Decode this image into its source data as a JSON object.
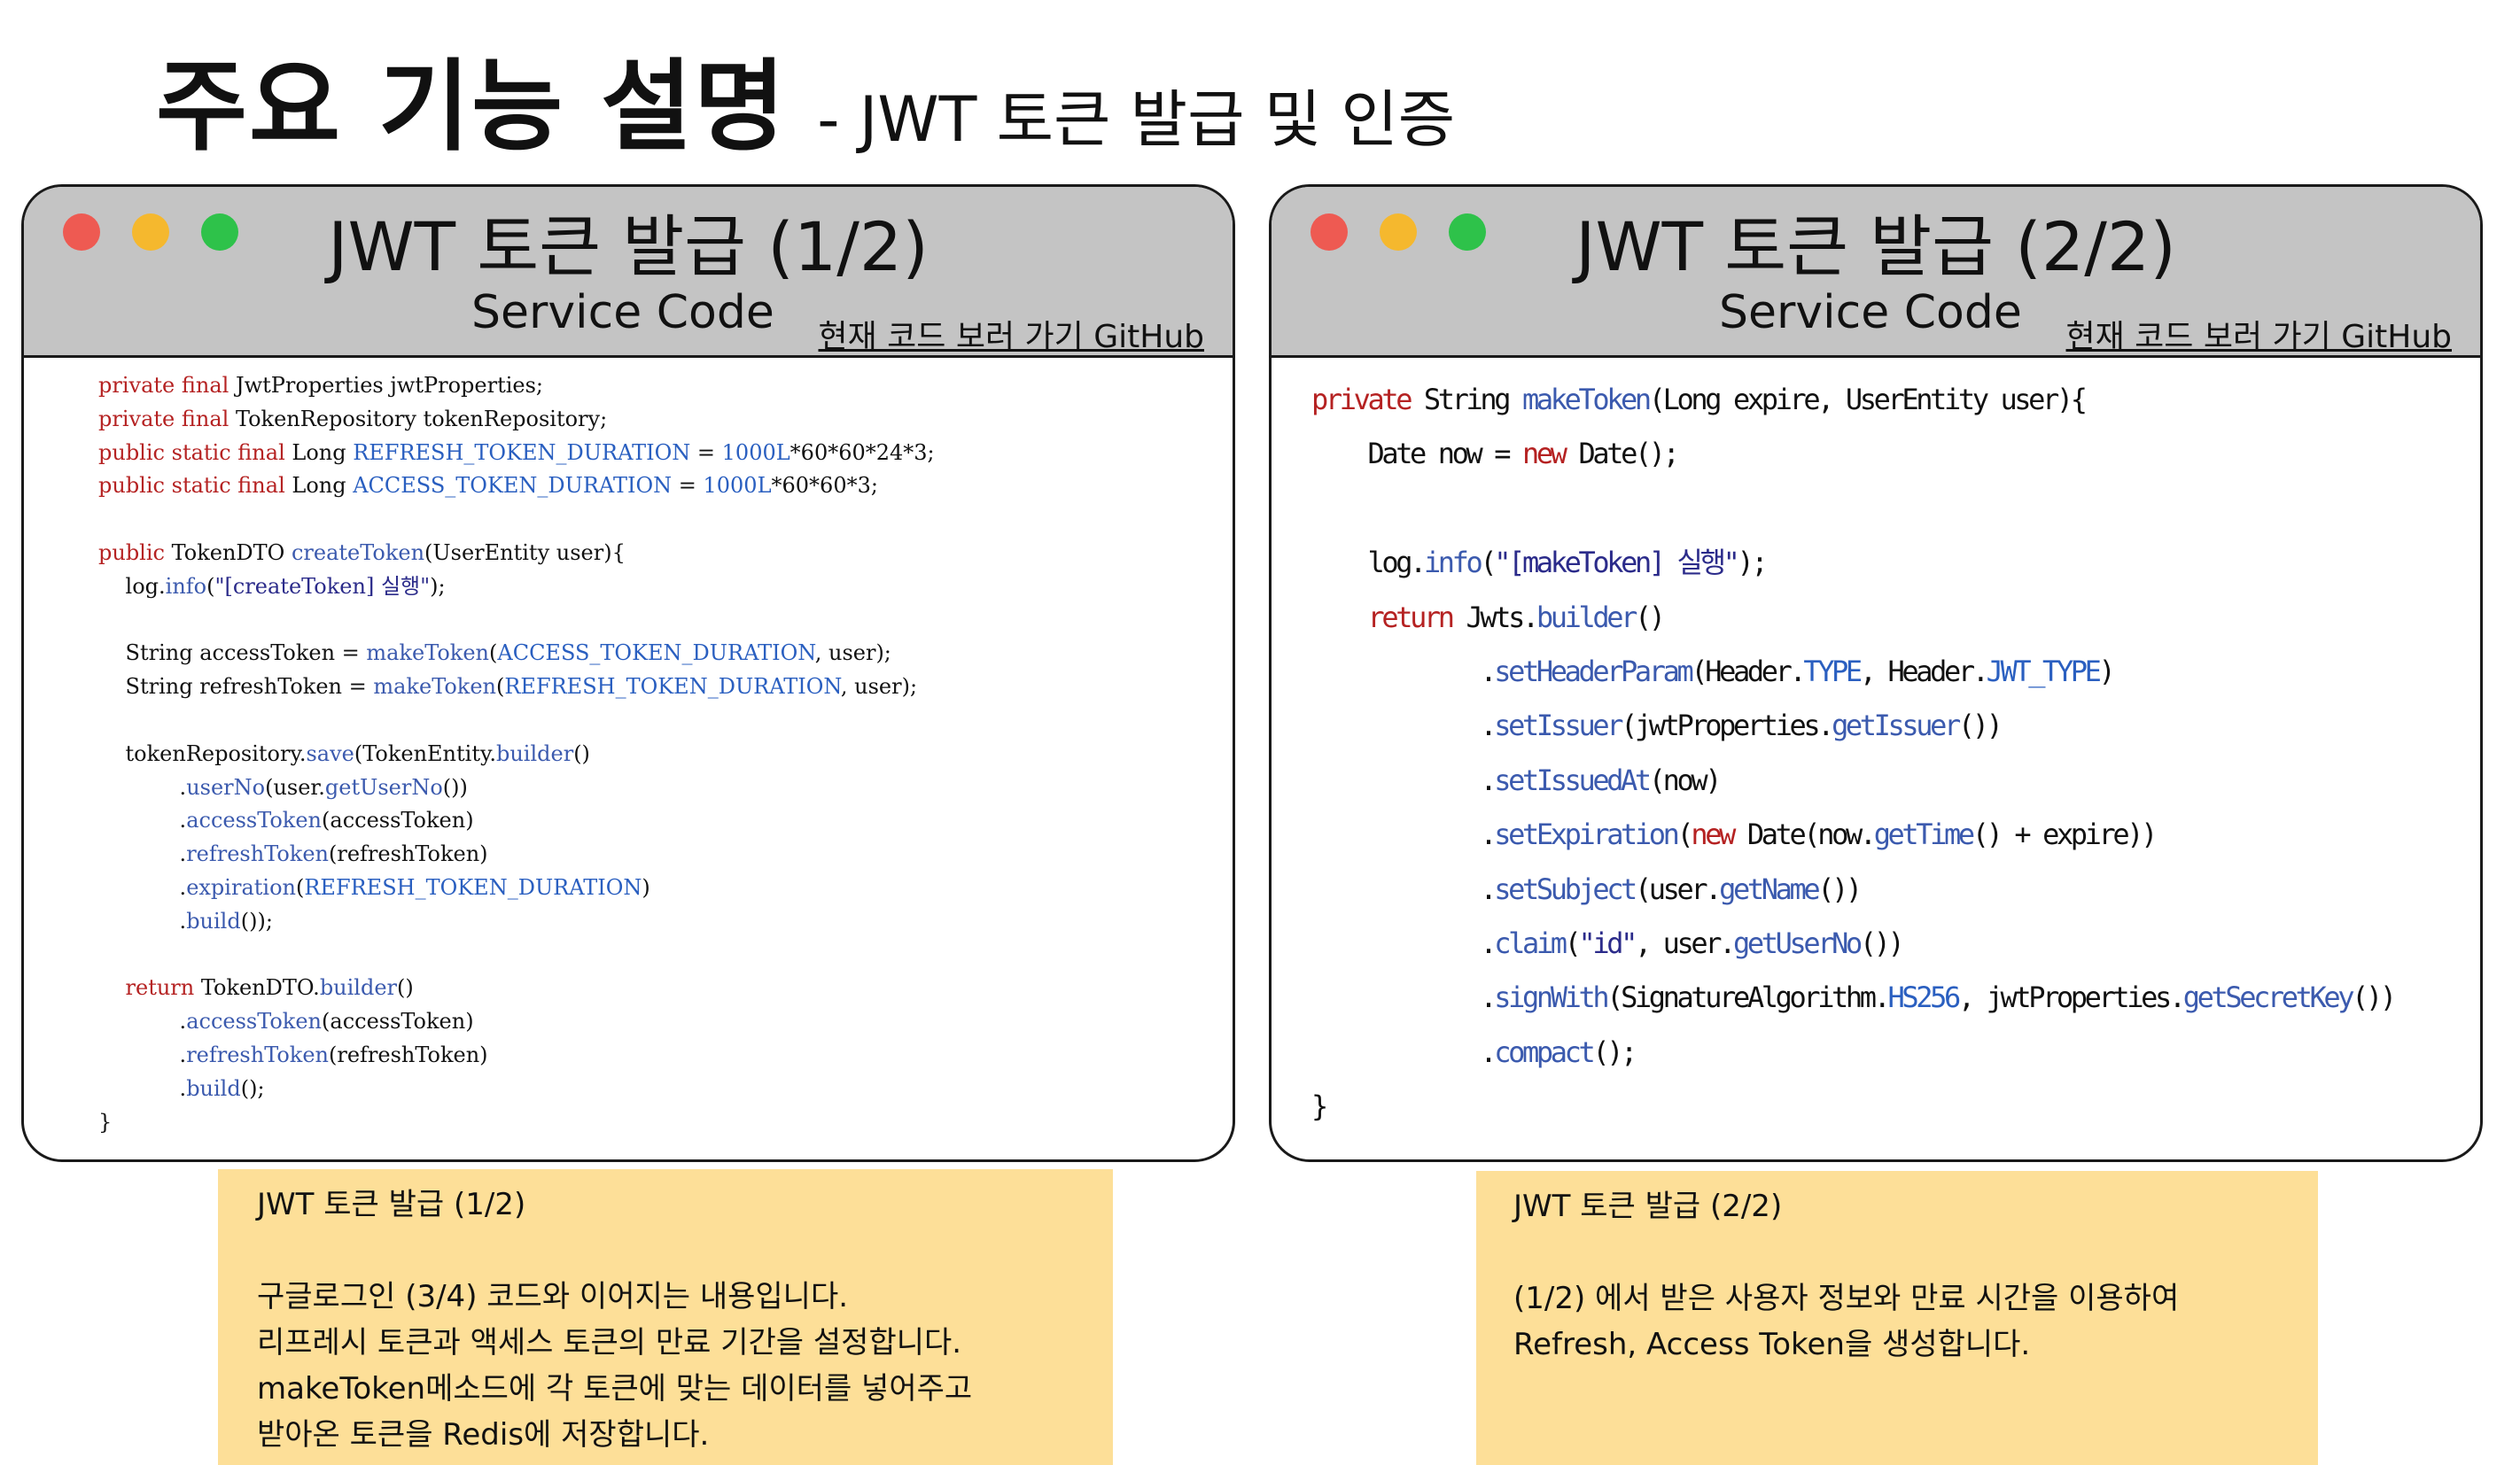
{
  "slide": {
    "title": "주요 기능 설명",
    "subtitle": "- JWT 토큰 발급 및 인증"
  },
  "windows": [
    {
      "title": "JWT 토큰 발급 (1/2)",
      "subtitle": "Service Code",
      "link": "현재 코드 보러 가기 GitHub",
      "code": [
        "private final JwtProperties jwtProperties;",
        "private final TokenRepository tokenRepository;",
        "public static final Long REFRESH_TOKEN_DURATION = 1000L*60*60*24*3;",
        "public static final Long ACCESS_TOKEN_DURATION = 1000L*60*60*3;",
        "",
        "public TokenDTO createToken(UserEntity user){",
        "    log.info(\"[createToken] 실행\");",
        "",
        "    String accessToken = makeToken(ACCESS_TOKEN_DURATION, user);",
        "    String refreshToken = makeToken(REFRESH_TOKEN_DURATION, user);",
        "",
        "    tokenRepository.save(TokenEntity.builder()",
        "            .userNo(user.getUserNo())",
        "            .accessToken(accessToken)",
        "            .refreshToken(refreshToken)",
        "            .expiration(REFRESH_TOKEN_DURATION)",
        "            .build());",
        "",
        "    return TokenDTO.builder()",
        "            .accessToken(accessToken)",
        "            .refreshToken(refreshToken)",
        "            .build();",
        "}"
      ]
    },
    {
      "title": "JWT 토큰 발급 (2/2)",
      "subtitle": "Service Code",
      "link": "현재 코드 보러 가기 GitHub",
      "code": [
        "private String makeToken(Long expire, UserEntity user){",
        "    Date now = new Date();",
        "",
        "    log.info(\"[makeToken] 실행\");",
        "    return Jwts.builder()",
        "            .setHeaderParam(Header.TYPE, Header.JWT_TYPE)",
        "            .setIssuer(jwtProperties.getIssuer())",
        "            .setIssuedAt(now)",
        "            .setExpiration(new Date(now.getTime() + expire))",
        "            .setSubject(user.getName())",
        "            .claim(\"id\", user.getUserNo())",
        "            .signWith(SignatureAlgorithm.HS256, jwtProperties.getSecretKey())",
        "            .compact();",
        "}"
      ]
    }
  ],
  "notes": [
    {
      "title": "JWT 토큰 발급 (1/2)",
      "lines": [
        "구글로그인 (3/4) 코드와 이어지는 내용입니다.",
        "리프레시 토큰과 액세스 토큰의  만료 기간을 설정합니다.",
        "makeToken메소드에 각 토큰에 맞는 데이터를 넣어주고",
        "받아온 토큰을 Redis에 저장합니다."
      ]
    },
    {
      "title": "JWT 토큰 발급 (2/2)",
      "lines": [
        "(1/2) 에서 받은 사용자 정보와 만료 시간을 이용하여",
        "Refresh, Access Token을 생성합니다."
      ]
    }
  ],
  "colors": {
    "titlebar": "#c4c4c4",
    "note_bg": "#fddf98",
    "dot_red": "#ee5a52",
    "dot_yellow": "#f5b82e",
    "dot_green": "#2ec24a",
    "code_keyword": "#b52222",
    "code_method": "#3b5aae",
    "code_constant": "#2a5fc0"
  }
}
